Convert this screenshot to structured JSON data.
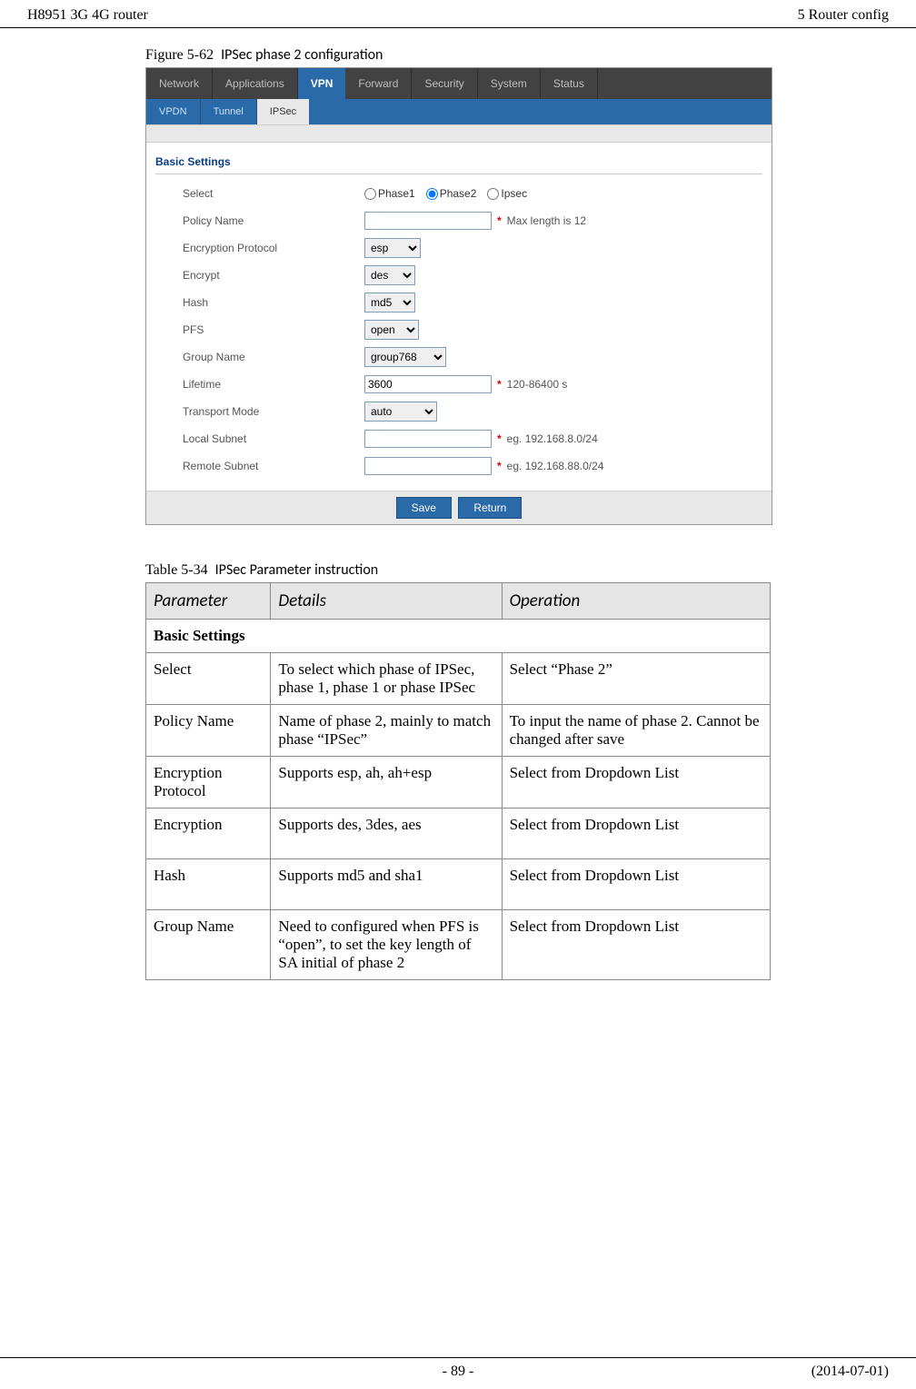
{
  "header": {
    "left": "H8951 3G 4G router",
    "right": "5  Router config"
  },
  "figure": {
    "num": "Figure 5-62",
    "title": "IPSec phase 2 configuration"
  },
  "main_tabs": [
    "Network",
    "Applications",
    "VPN",
    "Forward",
    "Security",
    "System",
    "Status"
  ],
  "sub_tabs": [
    "VPDN",
    "Tunnel",
    "IPSec"
  ],
  "section_title": "Basic Settings",
  "form": {
    "select_label": "Select",
    "select_options": [
      {
        "label": "Phase1",
        "checked": false
      },
      {
        "label": "Phase2",
        "checked": true
      },
      {
        "label": "Ipsec",
        "checked": false
      }
    ],
    "policy_name": {
      "label": "Policy Name",
      "value": "",
      "hint": "Max length is 12"
    },
    "enc_protocol": {
      "label": "Encryption Protocol",
      "value": "esp"
    },
    "encrypt": {
      "label": "Encrypt",
      "value": "des"
    },
    "hash": {
      "label": "Hash",
      "value": "md5"
    },
    "pfs": {
      "label": "PFS",
      "value": "open"
    },
    "group_name": {
      "label": "Group Name",
      "value": "group768"
    },
    "lifetime": {
      "label": "Lifetime",
      "value": "3600",
      "hint": "120-86400 s"
    },
    "transport_mode": {
      "label": "Transport Mode",
      "value": "auto"
    },
    "local_subnet": {
      "label": "Local Subnet",
      "value": "",
      "hint": "eg. 192.168.8.0/24"
    },
    "remote_subnet": {
      "label": "Remote Subnet",
      "value": "",
      "hint": "eg. 192.168.88.0/24"
    }
  },
  "buttons": {
    "save": "Save",
    "return": "Return"
  },
  "table_caption": {
    "num": "Table 5-34",
    "title": "IPSec Parameter instruction"
  },
  "table_headers": {
    "param": "Parameter",
    "details": "Details",
    "op": "Operation"
  },
  "table_basic": "Basic Settings",
  "table_rows": [
    {
      "param": "Select",
      "details": "To select which phase of IPSec, phase 1, phase 1 or phase IPSec",
      "op": "Select “Phase 2”"
    },
    {
      "param": "Policy Name",
      "details": "Name of phase 2, mainly to match phase “IPSec”",
      "op": "To input the name of phase 2. Cannot be changed after save"
    },
    {
      "param": "Encryption Protocol",
      "details": "Supports esp, ah, ah+esp",
      "op": "Select from Dropdown List"
    },
    {
      "param": "Encryption",
      "details": "Supports des, 3des, aes",
      "op": "Select from Dropdown List"
    },
    {
      "param": "Hash",
      "details": "Supports md5 and sha1",
      "op": "Select from Dropdown List"
    },
    {
      "param": "Group Name",
      "details": "Need to configured when PFS is “open”, to set the key length of SA initial of phase 2",
      "op": "Select from Dropdown List"
    }
  ],
  "footer": {
    "center": "- 89 -",
    "right": "(2014-07-01)"
  }
}
